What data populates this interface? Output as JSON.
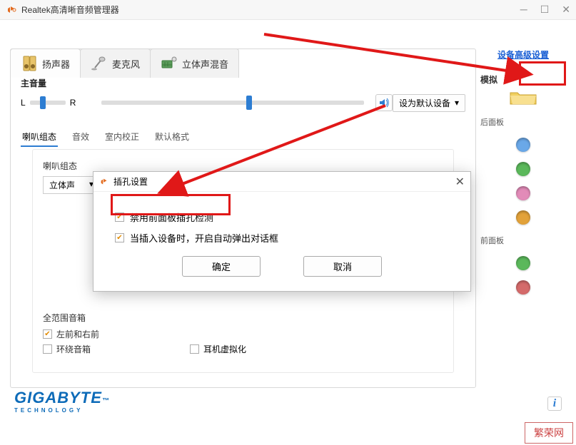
{
  "window": {
    "title": "Realtek高清晰音频管理器"
  },
  "tabs": {
    "speaker": "扬声器",
    "mic": "麦克风",
    "stereomix": "立体声混音"
  },
  "volume": {
    "section": "主音量",
    "left": "L",
    "right": "R",
    "set_default": "设为默认设备",
    "dropdown_caret": "▾"
  },
  "subtabs": {
    "config": "喇叭组态",
    "effects": "音效",
    "room": "室内校正",
    "format": "默认格式"
  },
  "config": {
    "label": "喇叭组态",
    "select_value": "立体声",
    "fullrange_label": "全范围音箱",
    "front_lr": "左前和右前",
    "surround": "环绕音箱",
    "headphone_virt": "耳机虚拟化"
  },
  "right": {
    "advanced": "设备高级设置",
    "analog": "模拟",
    "back_panel": "后面板",
    "front_panel": "前面板"
  },
  "dialog": {
    "title": "插孔设置",
    "opt1": "禁用前面板插孔检测",
    "opt2": "当插入设备时，开启自动弹出对话框",
    "ok": "确定",
    "cancel": "取消"
  },
  "brand": {
    "name": "GIGABYTE",
    "sub": "TECHNOLOGY",
    "tm": "™"
  },
  "footer": "繁荣网",
  "jack_colors": [
    "#6aa8e8",
    "#5bb85b",
    "#e28bb8",
    "#e2a23a",
    "#5bb85b",
    "#d46a6a"
  ]
}
